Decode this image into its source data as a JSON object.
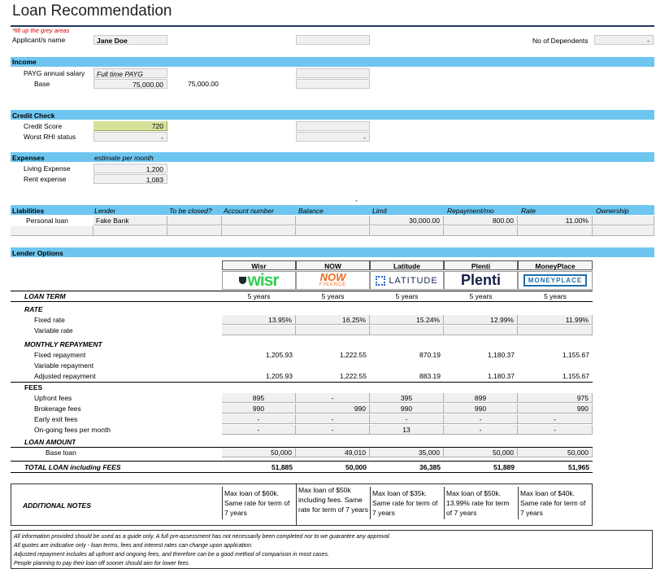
{
  "title": "Loan Recommendation",
  "fill_note": "*fill up the  grey  areas",
  "applicant": {
    "label": "Applicant/s name",
    "value": "Jane Doe",
    "dependents_label": "No of Dependents",
    "dependents_value": "-"
  },
  "income": {
    "header": "Income",
    "payg_label": "PAYG annual salary",
    "payg_type": "Full time PAYG",
    "base_label": "Base",
    "base_value": "75,000.00",
    "base_total": "75,000.00"
  },
  "credit": {
    "header": "Credit Check",
    "score_label": "Credit Score",
    "score_value": "720",
    "rhi_label": "Worst RHI status",
    "rhi_value": "-",
    "rhi_side": "-"
  },
  "expenses": {
    "header": "Expenses",
    "note": "estimate per month",
    "living_label": "Living Expense",
    "living_value": "1,200",
    "rent_label": "Rent expense",
    "rent_value": "1,083",
    "dash": "-"
  },
  "liabilities": {
    "header": "Liabilities",
    "columns": [
      "Lender",
      "To be closed?",
      "Account number",
      "Balance",
      "Limit",
      "Repayment/mo",
      "Rate",
      "Ownership"
    ],
    "row_label": "Personal loan",
    "row": {
      "lender": "Fake Bank",
      "limit": "30,000.00",
      "repayment": "800.00",
      "rate": "11.00%"
    }
  },
  "lender_options": {
    "header": "Lender Options",
    "lenders": [
      "Wisr",
      "NOW",
      "Latitude",
      "Plenti",
      "MoneyPlace"
    ],
    "logos": {
      "wisr": "wisr",
      "now_top": "NOW",
      "now_bottom": "FINANCE",
      "latitude": "LATITUDE",
      "plenti": "Plenti",
      "moneyplace": "MONEYPLACE"
    },
    "loan_term_label": "LOAN TERM",
    "loan_term": [
      "5 years",
      "5 years",
      "5 years",
      "5 years",
      "5 years"
    ],
    "rate_label": "RATE",
    "fixed_rate_label": "Fixed rate",
    "fixed_rate": [
      "13.95%",
      "16.25%",
      "15.24%",
      "12.99%",
      "11.99%"
    ],
    "variable_rate_label": "Variable rate",
    "monthly_label": "MONTHLY REPAYMENT",
    "fixed_repay_label": "Fixed repayment",
    "fixed_repay": [
      "1,205.93",
      "1,222.55",
      "870.19",
      "1,180.37",
      "1,155.67"
    ],
    "variable_repay_label": "Variable repayment",
    "adjusted_repay_label": "Adjusted repayment",
    "adjusted_repay": [
      "1,205.93",
      "1,222.55",
      "883.19",
      "1,180.37",
      "1,155.67"
    ],
    "fees_label": "FEES",
    "upfront_label": "Upfront fees",
    "upfront": [
      "895",
      "-",
      "395",
      "899",
      "975"
    ],
    "brokerage_label": "Brokerage fees",
    "brokerage": [
      "990",
      "990",
      "990",
      "990",
      "990"
    ],
    "early_label": "Early exit fees",
    "early": [
      "-",
      "-",
      "-",
      "-",
      "-"
    ],
    "ongoing_label": "On-going fees per month",
    "ongoing": [
      "-",
      "-",
      "13",
      "-",
      "-"
    ],
    "loan_amount_label": "LOAN AMOUNT",
    "base_loan_label": "Base loan",
    "base_loan": [
      "50,000",
      "49,010",
      "35,000",
      "50,000",
      "50,000"
    ],
    "total_label": "TOTAL LOAN including FEES",
    "total": [
      "51,885",
      "50,000",
      "36,385",
      "51,889",
      "51,965"
    ],
    "notes_label": "ADDITIONAL NOTES",
    "notes": [
      "Max loan of $60k. Same rate for term of 7 years",
      "Max loan of $50k including fees. Same rate for term of 7 years",
      "Max loan of $35k. Same rate for term of 7 years",
      "Max loan of $50k. 13.99% rate for term of 7 years",
      "Max loan of $40k. Same rate for term of 7 years"
    ]
  },
  "disclaimer": [
    "All information provided should be used as a guide only.  A full pre-assessment has not necessarily been completed nor to we guarantee any approval.",
    "All quotes are indicative only - loan terms, fees and interest rates can change upon application.",
    "Adjusted repayment includes all upfront and ongoing fees, and therefore can be a good method of comparison in most cases.",
    "People planning to pay their loan off sooner should aim for lower fees."
  ],
  "colors": {
    "band": "#6ec6f0",
    "title_rule": "#1f3864",
    "credit_score_fill": "#d7e19b",
    "grey_input": "#f0f0f0",
    "note_red": "#d00000"
  }
}
